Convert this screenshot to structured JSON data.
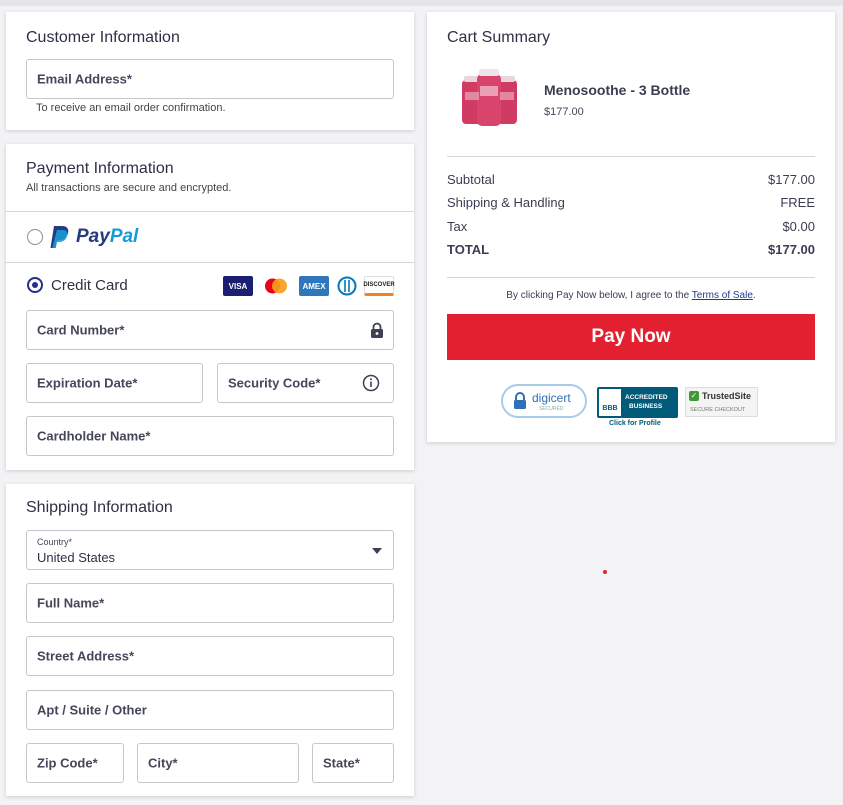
{
  "customer": {
    "title": "Customer Information",
    "email_placeholder": "Email Address*",
    "email_hint": "To receive an email order confirmation."
  },
  "payment": {
    "title": "Payment Information",
    "subtitle": "All transactions are secure and encrypted.",
    "paypal_label_1": "Pay",
    "paypal_label_2": "Pal",
    "credit_card_label": "Credit Card",
    "card_brands": [
      "VISA",
      "mastercard",
      "AMEX",
      "diners",
      "DISCOVER"
    ],
    "card_number_placeholder": "Card Number*",
    "expiration_placeholder": "Expiration Date*",
    "security_placeholder": "Security Code*",
    "cardholder_placeholder": "Cardholder Name*"
  },
  "shipping": {
    "title": "Shipping Information",
    "country_label": "Country*",
    "country_value": "United States",
    "full_name_placeholder": "Full Name*",
    "street_placeholder": "Street Address*",
    "apt_placeholder": "Apt / Suite / Other",
    "zip_placeholder": "Zip Code*",
    "city_placeholder": "City*",
    "state_placeholder": "State*"
  },
  "cart": {
    "title": "Cart Summary",
    "product_name": "Menosoothe - 3 Bottle",
    "product_price": "$177.00",
    "subtotal_label": "Subtotal",
    "subtotal_value": "$177.00",
    "shipping_label": "Shipping & Handling",
    "shipping_value": "FREE",
    "tax_label": "Tax",
    "tax_value": "$0.00",
    "total_label": "TOTAL",
    "total_value": "$177.00",
    "terms_prefix": "By clicking Pay Now below, I agree to the ",
    "terms_link": "Terms of Sale",
    "terms_suffix": ".",
    "pay_button": "Pay Now",
    "badges": {
      "digicert": "digicert",
      "digicert_sub": "SECURED",
      "bbb_1": "ACCREDITED",
      "bbb_2": "BUSINESS",
      "bbb_logo": "BBB",
      "bbb_link": "Click for Profile",
      "trusted": "TrustedSite",
      "trusted_sub": "SECURE CHECKOUT"
    }
  },
  "colors": {
    "accent": "#262c8f",
    "pay_button": "#e3202f",
    "background": "#f3f3f6"
  }
}
